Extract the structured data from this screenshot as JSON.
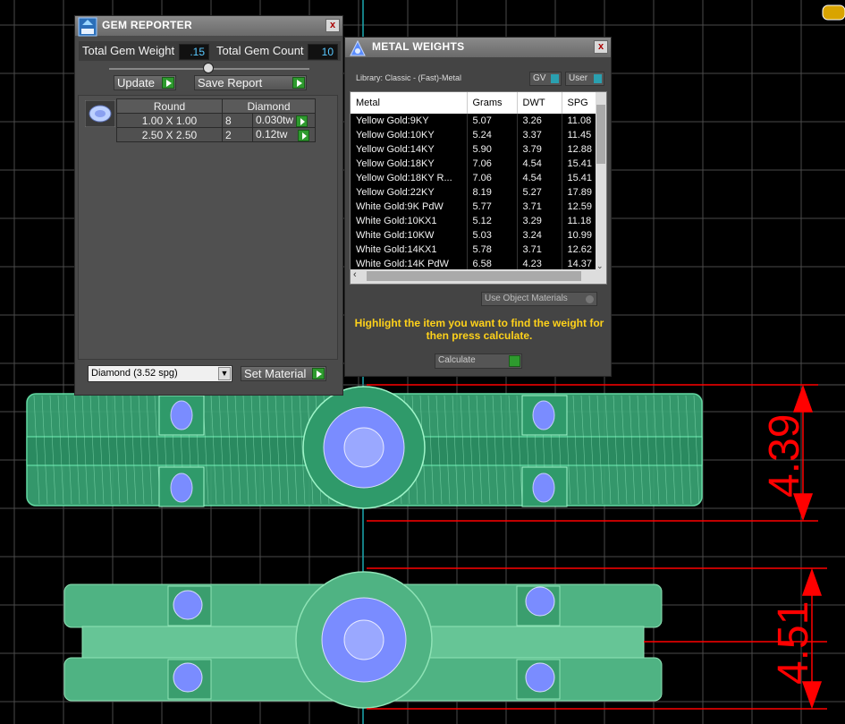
{
  "gem_reporter": {
    "title": "GEM REPORTER",
    "close": "x",
    "total_weight_label": "Total Gem Weight",
    "total_weight_value": ".15",
    "total_count_label": "Total Gem Count",
    "total_count_value": "10",
    "update_label": "Update",
    "save_report_label": "Save Report",
    "table": {
      "headers": [
        "Round",
        "Diamond"
      ],
      "rows": [
        {
          "size": "1.00 X 1.00",
          "count": "8",
          "weight": "0.030tw"
        },
        {
          "size": "2.50 X 2.50",
          "count": "2",
          "weight": "0.12tw"
        }
      ]
    },
    "material_select": "Diamond      (3.52 spg)",
    "set_material_label": "Set Material"
  },
  "metal_weights": {
    "title": "METAL WEIGHTS",
    "close": "x",
    "library": "Library: Classic - (Fast)-Metal",
    "gv_label": "GV",
    "user_label": "User",
    "columns": [
      "Metal",
      "Grams",
      "DWT",
      "SPG"
    ],
    "rows": [
      [
        "Yellow Gold:9KY",
        "5.07",
        "3.26",
        "11.08"
      ],
      [
        "Yellow Gold:10KY",
        "5.24",
        "3.37",
        "11.45"
      ],
      [
        "Yellow Gold:14KY",
        "5.90",
        "3.79",
        "12.88"
      ],
      [
        "Yellow Gold:18KY",
        "7.06",
        "4.54",
        "15.41"
      ],
      [
        "Yellow Gold:18KY R...",
        "7.06",
        "4.54",
        "15.41"
      ],
      [
        "Yellow Gold:22KY",
        "8.19",
        "5.27",
        "17.89"
      ],
      [
        "White Gold:9K PdW",
        "5.77",
        "3.71",
        "12.59"
      ],
      [
        "White Gold:10KX1",
        "5.12",
        "3.29",
        "11.18"
      ],
      [
        "White Gold:10KW",
        "5.03",
        "3.24",
        "10.99"
      ],
      [
        "White Gold:14KX1",
        "5.78",
        "3.71",
        "12.62"
      ],
      [
        "White Gold:14K PdW",
        "6.58",
        "4.23",
        "14.37"
      ]
    ],
    "use_object_materials": "Use Object Materials",
    "hint": "Highlight the item you want to find the weight for then press calculate.",
    "calculate_label": "Calculate"
  },
  "dimensions": {
    "top": "4.39",
    "bottom": "4.51"
  },
  "colors": {
    "mesh": "#3fbf8a",
    "stone": "#7a8cff",
    "dimension": "#ff0000",
    "grid": "#555555",
    "axis": "#1aa7b0"
  }
}
